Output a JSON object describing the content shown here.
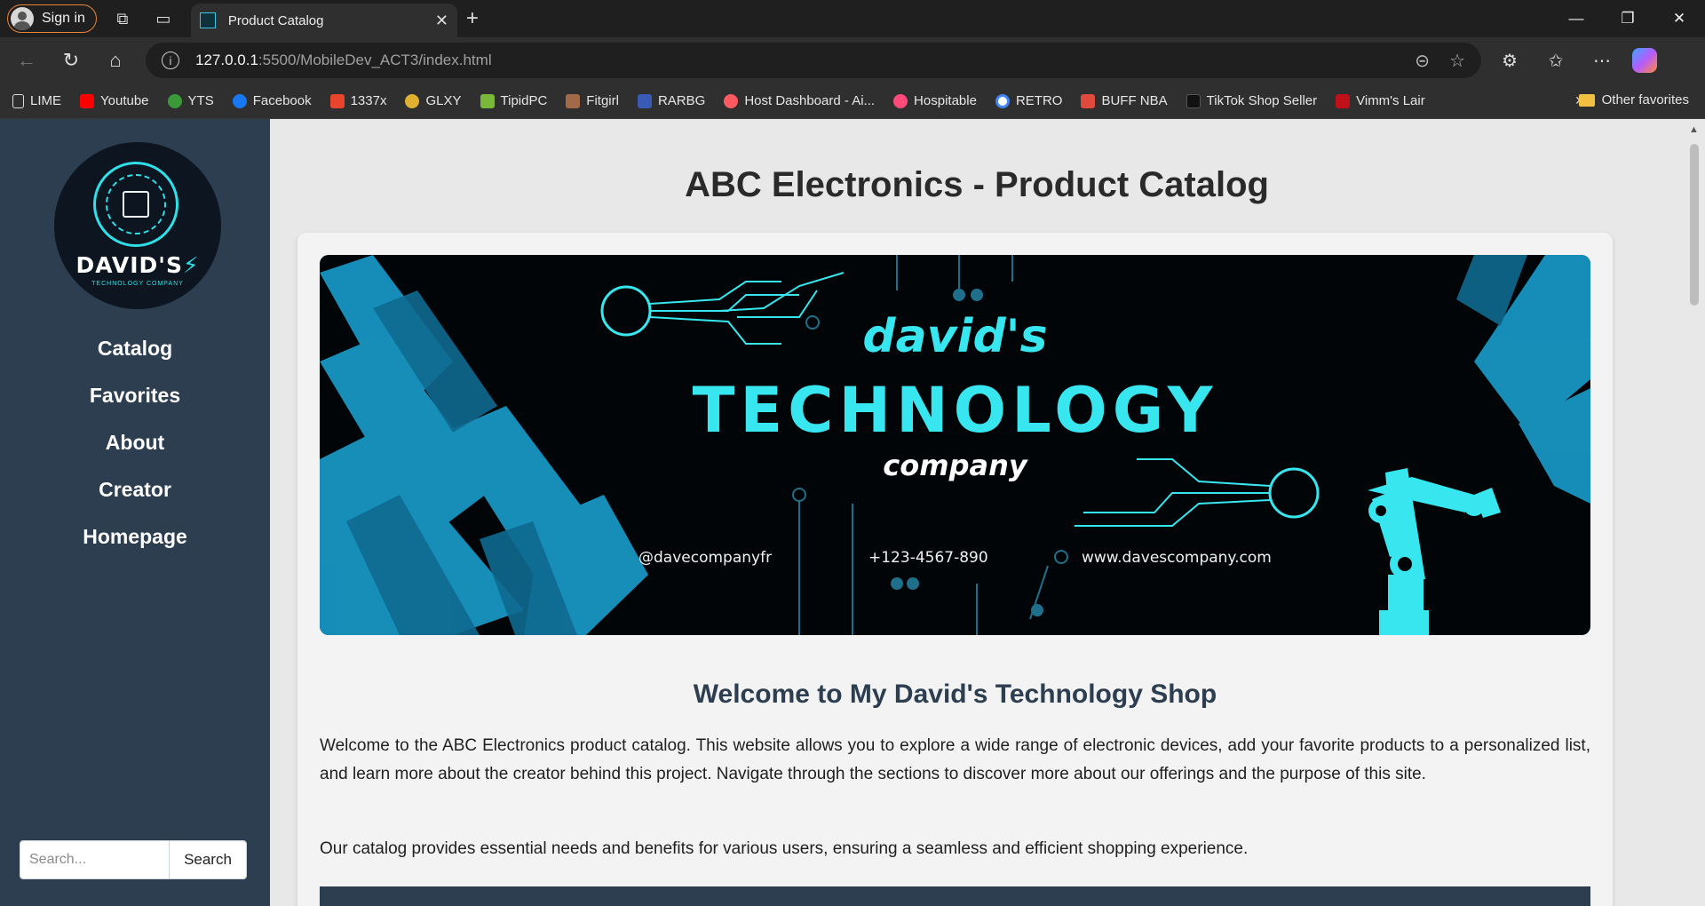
{
  "browser": {
    "signin_label": "Sign in",
    "tab_title": "Product Catalog",
    "url_host": "127.0.0.1",
    "url_path": ":5500/MobileDev_ACT3/index.html",
    "bookmarks": [
      "LIME",
      "Youtube",
      "YTS",
      "Facebook",
      "1337x",
      "GLXY",
      "TipidPC",
      "Fitgirl",
      "RARBG",
      "Host Dashboard - Ai...",
      "Hospitable",
      "RETRO",
      "BUFF NBA",
      "TikTok Shop Seller",
      "Vimm's Lair"
    ],
    "other_favorites": "Other favorites"
  },
  "sidebar": {
    "logo_brand": "DAVID'S",
    "logo_sub": "TECHNOLOGY COMPANY",
    "nav": [
      "Catalog",
      "Favorites",
      "About",
      "Creator",
      "Homepage"
    ],
    "search_placeholder": "Search...",
    "search_button": "Search"
  },
  "main": {
    "title": "ABC Electronics - Product Catalog",
    "banner": {
      "line1": "david's",
      "line2": "TECHNOLOGY",
      "line3": "company",
      "handle": "@davecompanyfr",
      "phone": "+123-4567-890",
      "website": "www.davescompany.com"
    },
    "welcome_title": "Welcome to My David's Technology Shop",
    "paragraph1": "Welcome to the ABC Electronics product catalog. This website allows you to explore a wide range of electronic devices, add your favorite products to a personalized list, and learn more about the creator behind this project. Navigate through the sections to discover more about our offerings and the purpose of this site.",
    "paragraph2": "Our catalog provides essential needs and benefits for various users, ensuring a seamless and efficient shopping experience."
  },
  "colors": {
    "sidebar": "#2c3e50",
    "accent_cyan": "#37e6ef",
    "signin_border": "#e8833a"
  }
}
